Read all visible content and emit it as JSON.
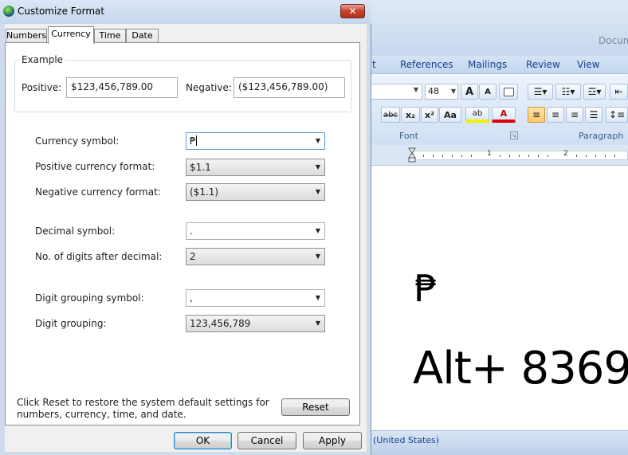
{
  "dialog": {
    "title": "Customize Format",
    "close_glyph": "✕",
    "tabs": [
      {
        "label": "Numbers"
      },
      {
        "label": "Currency"
      },
      {
        "label": "Time"
      },
      {
        "label": "Date"
      }
    ],
    "selected_tab": "Currency",
    "example": {
      "legend": "Example",
      "positive_label": "Positive:",
      "positive_value": "$123,456,789.00",
      "negative_label": "Negative:",
      "negative_value": "($123,456,789.00)"
    },
    "fields": {
      "currency_symbol": {
        "label": "Currency symbol:",
        "value": "₱"
      },
      "positive_format": {
        "label": "Positive currency format:",
        "value": "$1.1"
      },
      "negative_format": {
        "label": "Negative currency format:",
        "value": "($1.1)"
      },
      "decimal_symbol": {
        "label": "Decimal symbol:",
        "value": "."
      },
      "digits_after_decimal": {
        "label": "No. of digits after decimal:",
        "value": "2"
      },
      "digit_grouping_symbol": {
        "label": "Digit grouping symbol:",
        "value": ","
      },
      "digit_grouping": {
        "label": "Digit grouping:",
        "value": "123,456,789"
      }
    },
    "reset_note": "Click Reset to restore the system default settings for numbers, currency, time, and date.",
    "buttons": {
      "reset": "Reset",
      "ok": "OK",
      "cancel": "Cancel",
      "apply": "Apply"
    }
  },
  "word": {
    "doc_title": "Docum",
    "tabs": [
      "t",
      "References",
      "Mailings",
      "Review",
      "View"
    ],
    "font_size": "48",
    "group_labels": {
      "font": "Font",
      "paragraph": "Paragraph"
    },
    "font_buttons": {
      "grow": "A",
      "shrink": "A",
      "strike": "abc",
      "subscript": "x₂",
      "superscript": "x²",
      "change_case": "Aa",
      "highlight": "ab",
      "font_color": "A"
    },
    "ruler_numbers": [
      "1",
      "2"
    ],
    "document": {
      "symbol": "₱",
      "text": "Alt+ 8369"
    },
    "status": "(United States)"
  },
  "colors": {
    "accent": "#15428b",
    "close_red": "#c4402a",
    "ribbon_blue": "#cfdff3"
  }
}
